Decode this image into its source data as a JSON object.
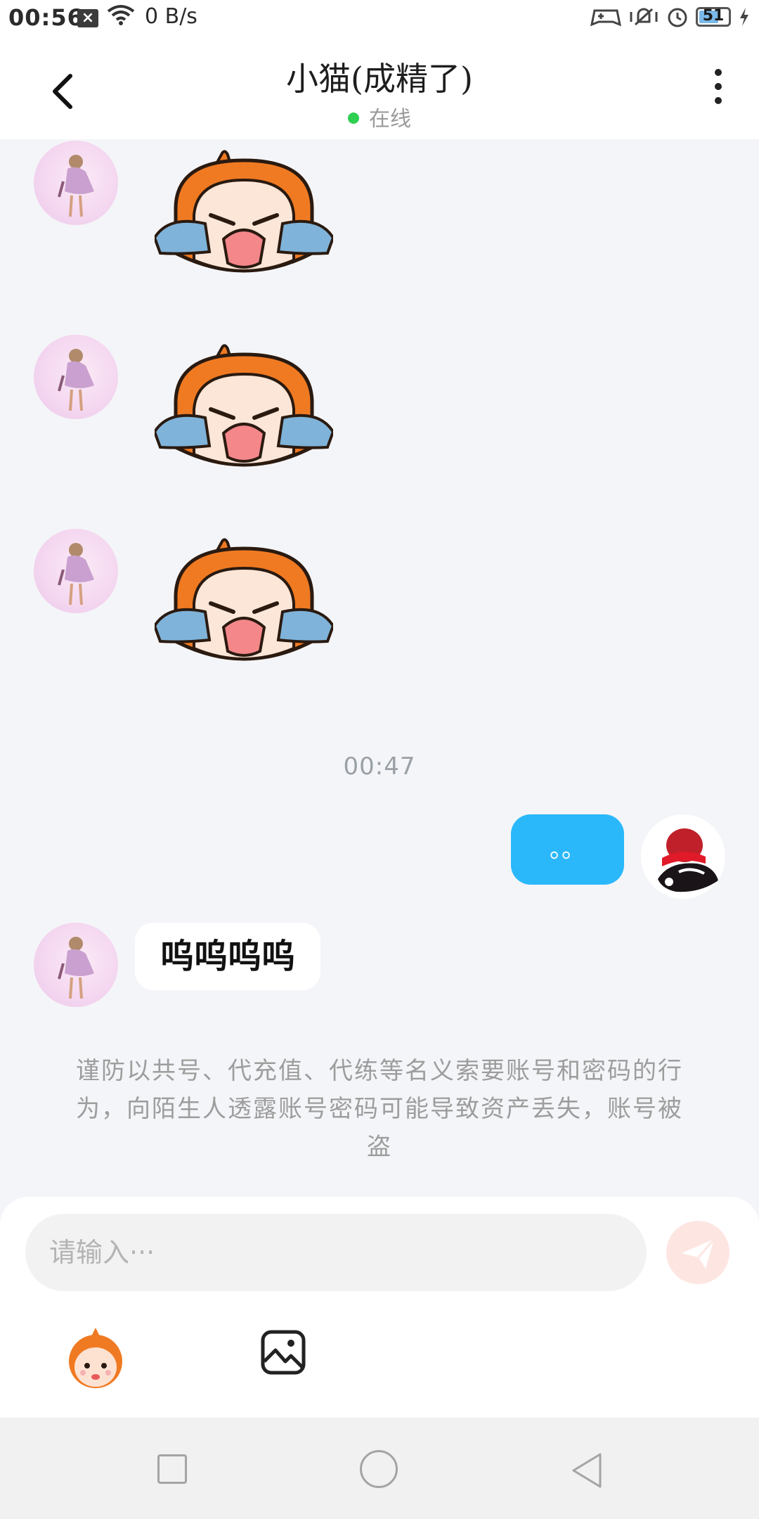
{
  "status_bar": {
    "time": "00:56",
    "net_speed": "0 B/s",
    "battery": "51"
  },
  "header": {
    "title": "小猫(成精了)",
    "status": "在线"
  },
  "messages": {
    "timestamp": "00:47",
    "my_message": "。。",
    "her_message": "呜呜呜呜"
  },
  "warning_text": "谨防以共号、代充值、代练等名义索要账号和密码的行为，向陌生人透露账号密码可能导致资产丢失，账号被盗",
  "composer": {
    "placeholder": "请输入···"
  },
  "icons": {
    "back": "chevron-left-icon",
    "more": "more-vertical-icon",
    "send": "send-icon",
    "emoji": "emoji-icon",
    "image": "image-icon"
  },
  "colors": {
    "my_bubble": "#2bb8fb",
    "online": "#2fcf52",
    "send_disabled": "#fde6e2",
    "chat_bg": "#f4f5f8"
  }
}
